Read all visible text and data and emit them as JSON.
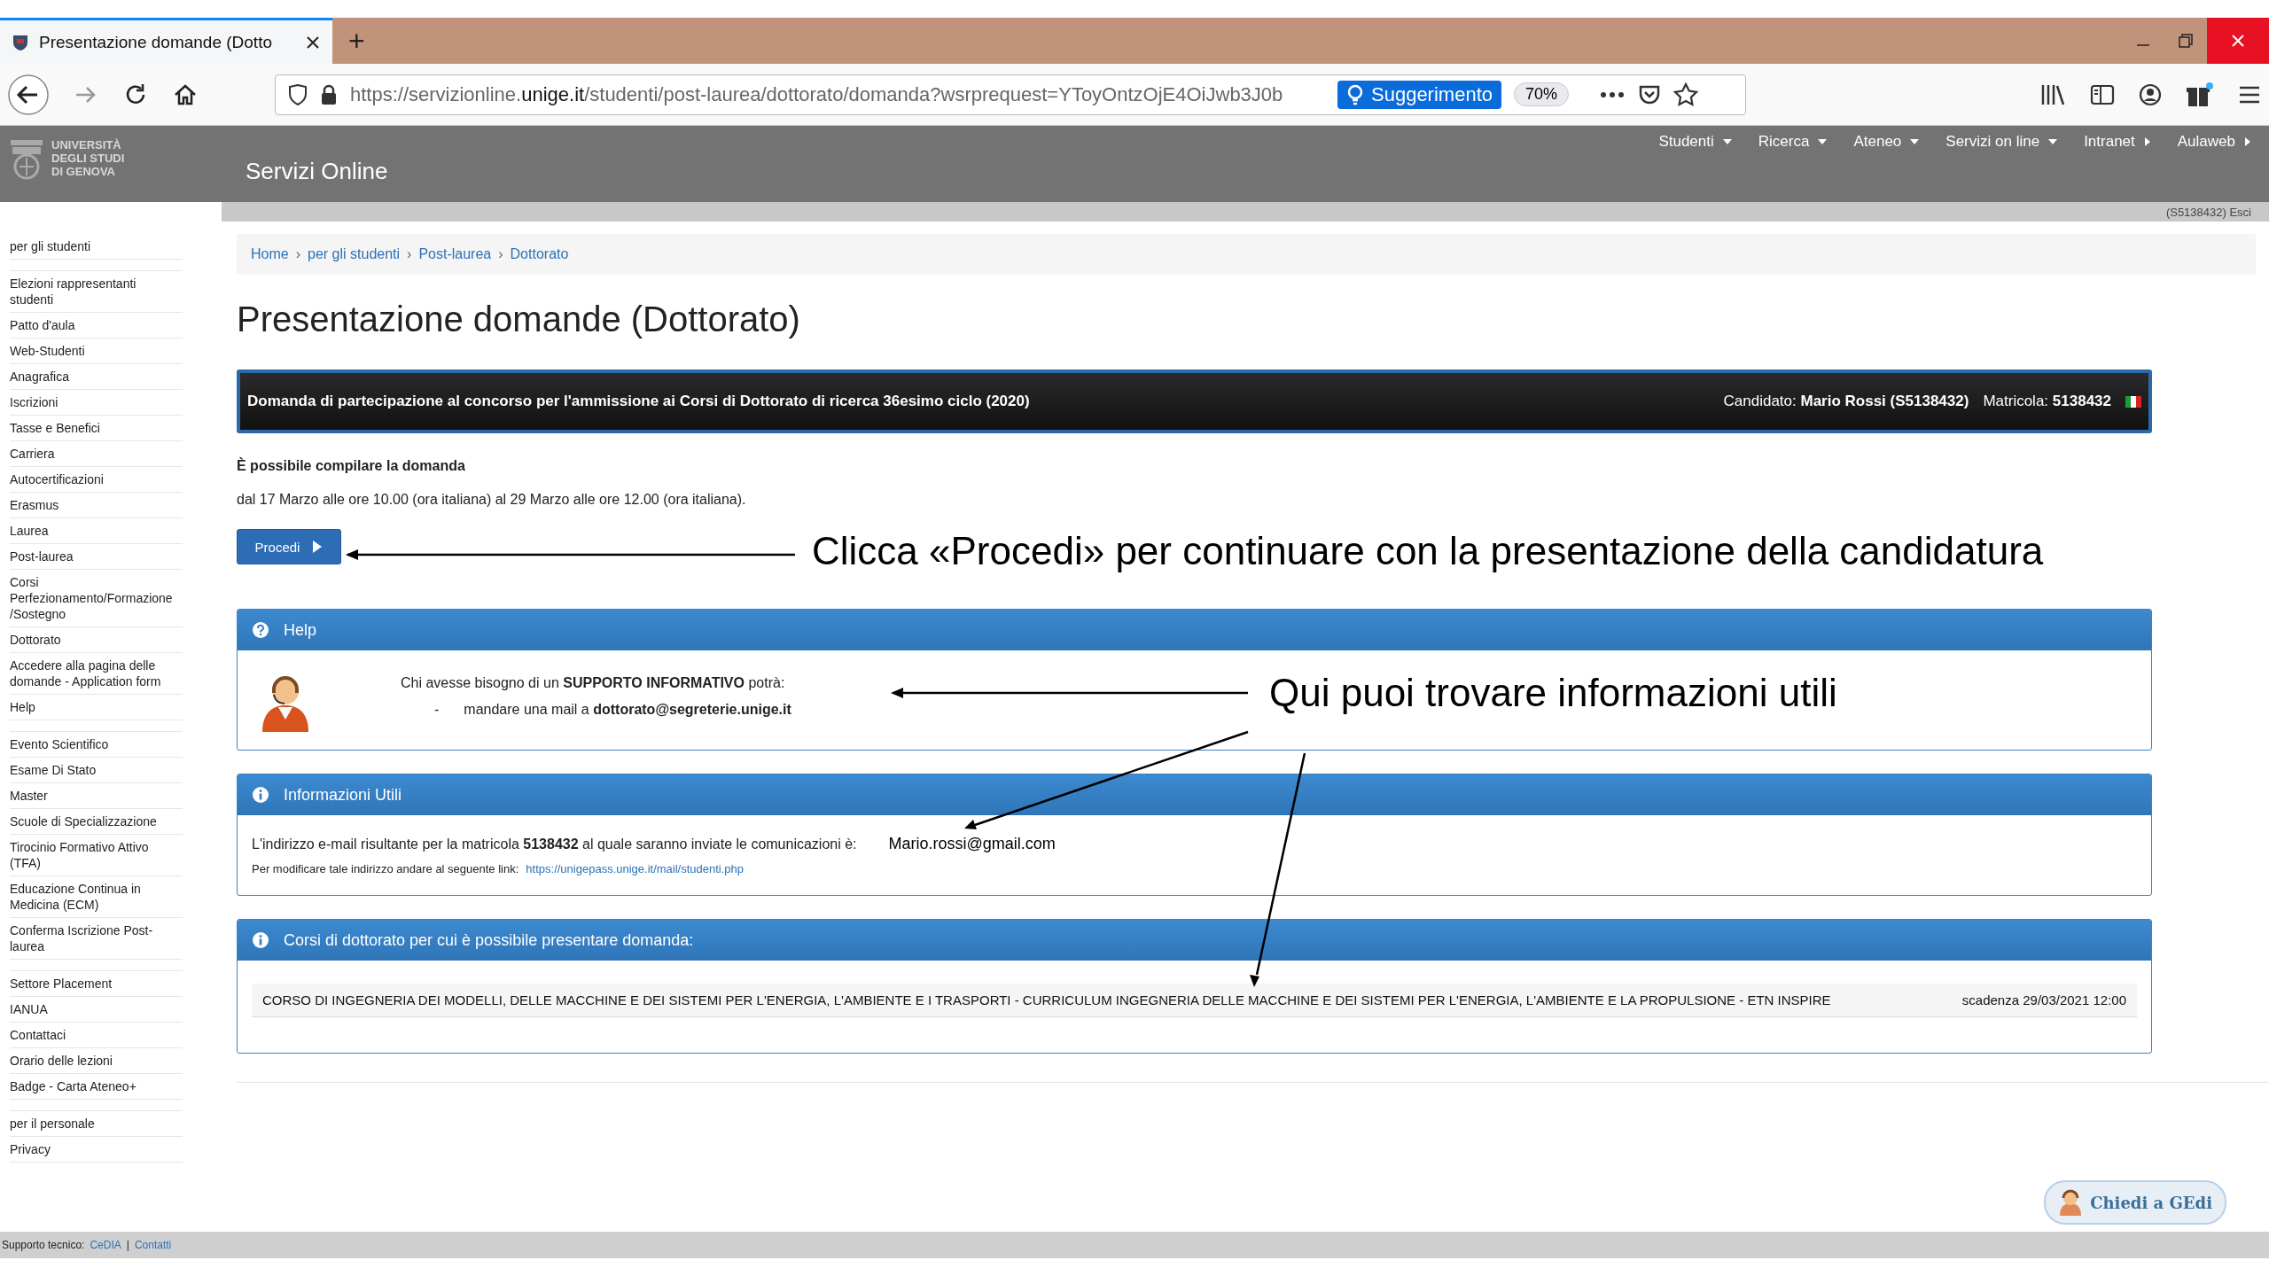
{
  "browser": {
    "tab_title": "Presentazione domande (Dotto",
    "new_tab": "+",
    "url_prefix": "https://servizionline.",
    "url_domain": "unige.it",
    "url_rest": "/studenti/post-laurea/dottorato/domanda?wsrprequest=YToyOntzOjE4OiJwb3J0b",
    "suggestion": "Suggerimento",
    "zoom": "70%"
  },
  "site": {
    "logo_lines": [
      "UNIVERSITÀ",
      "DEGLI STUDI",
      "DI GENOVA"
    ],
    "title": "Servizi Online",
    "nav": [
      {
        "label": "Studenti",
        "opens_down": true
      },
      {
        "label": "Ricerca",
        "opens_down": true
      },
      {
        "label": "Ateneo",
        "opens_down": true
      },
      {
        "label": "Servizi on line",
        "opens_down": true
      },
      {
        "label": "Intranet",
        "opens_down": false
      },
      {
        "label": "Aulaweb",
        "opens_down": false
      }
    ],
    "user_link": "(S5138432) Esci"
  },
  "sidebar": {
    "groups": [
      [
        "per gli studenti"
      ],
      [
        "Elezioni rappresentanti studenti",
        "Patto d'aula",
        "Web-Studenti",
        "Anagrafica",
        "Iscrizioni",
        "Tasse e Benefici",
        "Carriera",
        "Autocertificazioni",
        "Erasmus",
        "Laurea",
        "Post-laurea",
        "Corsi Perfezionamento/Formazione /Sostegno",
        "Dottorato",
        "Accedere alla pagina delle domande - Application form",
        "Help"
      ],
      [
        "Evento Scientifico",
        "Esame Di Stato",
        "Master",
        "Scuole di Specializzazione",
        "Tirocinio Formativo Attivo (TFA)",
        "Educazione Continua in Medicina (ECM)",
        "Conferma Iscrizione Post-laurea"
      ],
      [
        "Settore Placement",
        "IANUA",
        "Contattaci",
        "Orario delle lezioni",
        "Badge - Carta Ateneo+"
      ],
      [
        "per il personale",
        "Privacy"
      ]
    ]
  },
  "breadcrumb": {
    "items": [
      "Home",
      "per gli studenti",
      "Post-laurea",
      "Dottorato"
    ],
    "separator": "›"
  },
  "page_title": "Presentazione domande (Dottorato)",
  "banner": {
    "title": "Domanda di partecipazione al concorso per l'ammissione ai Corsi di Dottorato di ricerca 36esimo ciclo (2020)",
    "candidate": "Candidato: **Mario Rossi (S5138432)**",
    "matricola": "Matricola: **5138432**"
  },
  "notice": {
    "title": "È possibile compilare la domanda",
    "dates": "dal 17 Marzo alle ore 10.00 (ora italiana) al 29 Marzo alle ore 12.00 (ora italiana)."
  },
  "proceed_button": "Procedi",
  "help_panel": {
    "title": "Help",
    "line": "Chi avesse bisogno di un **SUPPORTO INFORMATIVO** potrà:",
    "bullet": "-",
    "item": "mandare una mail a **dottorato@segreterie.unige.it**"
  },
  "info_panel": {
    "title": "Informazioni Utili",
    "line": "L'indirizzo e-mail risultante per la matricola **5138432** al quale saranno inviate le comunicazioni è:",
    "email": "Mario.rossi@gmail.com",
    "note": "Per modificare tale indirizzo andare al seguente link:",
    "link": "https://unigepass.unige.it/mail/studenti.php"
  },
  "courses_panel": {
    "title": "Corsi di dottorato per cui è possibile presentare domanda:",
    "rows": [
      {
        "course": "CORSO DI INGEGNERIA DEI MODELLI, DELLE MACCHINE E DEI SISTEMI PER L'ENERGIA, L'AMBIENTE E I TRASPORTI - CURRICULUM INGEGNERIA DELLE MACCHINE E DEI SISTEMI PER L'ENERGIA, L'AMBIENTE E LA PROPULSIONE - ETN INSPIRE",
        "deadline": "scadenza 29/03/2021 12:00"
      }
    ]
  },
  "annotations": [
    "Clicca «Procedi» per continuare con la presentazione della candidatura",
    "Qui puoi trovare informazioni utili"
  ],
  "footer": {
    "label": "Supporto tecnico:",
    "links": [
      "CeDIA",
      "Contatti"
    ],
    "separator": "|"
  },
  "chat_button": "Chiedi a GEdi"
}
